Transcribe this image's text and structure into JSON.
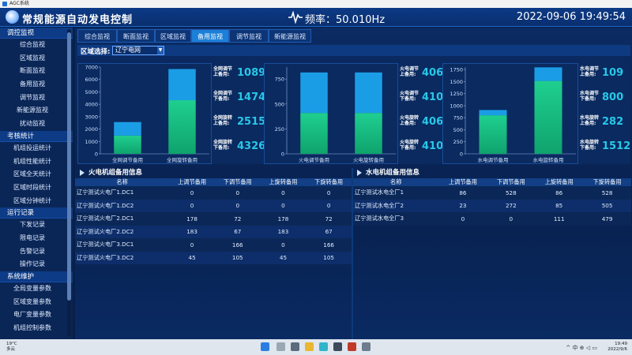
{
  "window": {
    "title": "AGC系统"
  },
  "header": {
    "title": "常规能源自动发电控制",
    "freq_text": "频率：50.010Hz",
    "datetime": "2022-09-06 19:49:54"
  },
  "sidebar": {
    "groups": [
      {
        "label": "调控监视",
        "items": [
          "综合监视",
          "区域监视",
          "断面监视",
          "备用监视",
          "调节监视",
          "新能源监视",
          "扰动监视"
        ]
      },
      {
        "label": "考核统计",
        "items": [
          "机组投运统计",
          "机组性能统计",
          "区域全天统计",
          "区域时段统计",
          "区域分钟统计"
        ]
      },
      {
        "label": "运行记录",
        "items": [
          "下发记录",
          "限电记录",
          "告警记录",
          "操作记录"
        ]
      },
      {
        "label": "系统维护",
        "items": [
          "全局变量参数",
          "区域变量参数",
          "电厂变量参数",
          "机组控制参数"
        ]
      }
    ]
  },
  "tabs": [
    "综合监视",
    "断面监视",
    "区域监视",
    "备用监视",
    "调节监视",
    "新能源监视"
  ],
  "active_tab": 3,
  "region": {
    "label": "区域选择:",
    "selected": "辽宁电网",
    "arrow": "▼"
  },
  "chart_data": [
    {
      "type": "bar",
      "categories": [
        "全网调节备用",
        "全网旋转备用"
      ],
      "series": [
        {
          "values": [
            1474,
            4326
          ],
          "color": "#1fcf8f"
        },
        {
          "values": [
            1089,
            2515
          ],
          "color": "#1b9de6"
        }
      ],
      "stacked": true,
      "ylim": [
        0,
        7000
      ],
      "ticks": [
        7000.0,
        6000.0,
        5000.0,
        4000.0,
        3000.0,
        2000.0,
        1000.0,
        0.0
      ]
    },
    {
      "type": "bar",
      "categories": [
        "火电调节备用",
        "火电旋转备用"
      ],
      "series": [
        {
          "values": [
            410,
            410
          ],
          "color": "#1fcf8f"
        },
        {
          "values": [
            406,
            406
          ],
          "color": "#1b9de6"
        }
      ],
      "stacked": true,
      "ylim": [
        0,
        870
      ],
      "ticks": [
        750.0,
        500.0,
        250.0,
        0.0
      ]
    },
    {
      "type": "bar",
      "categories": [
        "水电调节备用",
        "水电旋转备用"
      ],
      "series": [
        {
          "values": [
            800,
            1512
          ],
          "color": "#1fcf8f"
        },
        {
          "values": [
            109,
            282
          ],
          "color": "#1b9de6"
        }
      ],
      "stacked": true,
      "ylim": [
        0,
        1800
      ],
      "ticks": [
        1750.0,
        1500.0,
        1250.0,
        1000.0,
        750.0,
        500.0,
        250.0,
        0.0
      ]
    }
  ],
  "stats": [
    [
      {
        "label": "全网调节\n上备用:",
        "value": "1089"
      },
      {
        "label": "全网调节\n下备用:",
        "value": "1474"
      },
      {
        "label": "全网旋转\n上备用:",
        "value": "2515"
      },
      {
        "label": "全网旋转\n下备用:",
        "value": "4326"
      }
    ],
    [
      {
        "label": "火电调节\n上备用:",
        "value": "406"
      },
      {
        "label": "火电调节\n下备用:",
        "value": "410"
      },
      {
        "label": "火电旋转\n上备用:",
        "value": "406"
      },
      {
        "label": "火电旋转\n下备用:",
        "value": "410"
      }
    ],
    [
      {
        "label": "水电调节\n上备用:",
        "value": "109"
      },
      {
        "label": "水电调节\n下备用:",
        "value": "800"
      },
      {
        "label": "水电旋转\n上备用:",
        "value": "282"
      },
      {
        "label": "水电旋转\n下备用:",
        "value": "1512"
      }
    ]
  ],
  "thermal": {
    "title": "火电机组备用信息",
    "columns": [
      "名称",
      "上调节备用",
      "下调节备用",
      "上旋转备用",
      "下旋转备用"
    ],
    "rows": [
      [
        "辽宁测试火电厂1.DC1",
        "0",
        "0",
        "0",
        "0"
      ],
      [
        "辽宁测试火电厂1.DC2",
        "0",
        "0",
        "0",
        "0"
      ],
      [
        "辽宁测试火电厂2.DC1",
        "178",
        "72",
        "178",
        "72"
      ],
      [
        "辽宁测试火电厂2.DC2",
        "183",
        "67",
        "183",
        "67"
      ],
      [
        "辽宁测试火电厂3.DC1",
        "0",
        "166",
        "0",
        "166"
      ],
      [
        "辽宁测试火电厂3.DC2",
        "45",
        "105",
        "45",
        "105"
      ]
    ]
  },
  "hydro": {
    "title": "水电机组备用信息",
    "columns": [
      "名称",
      "上调节备用",
      "下调节备用",
      "上旋转备用",
      "下旋转备用"
    ],
    "rows": [
      [
        "辽宁测试水电全厂1",
        "86",
        "528",
        "86",
        "528"
      ],
      [
        "辽宁测试水电全厂2",
        "23",
        "272",
        "85",
        "505"
      ],
      [
        "辽宁测试水电全厂3",
        "0",
        "0",
        "111",
        "479"
      ]
    ]
  },
  "taskbar": {
    "temp": "19°C",
    "weather": "多云",
    "time": "19:49",
    "date": "2022/9/6",
    "tray": "^ 中 ⊕ ◁ ▭"
  }
}
